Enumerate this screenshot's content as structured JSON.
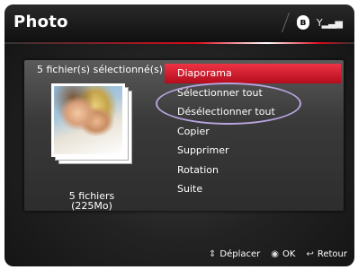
{
  "header": {
    "title": "Photo",
    "icons": [
      "bluetooth-icon",
      "signal-icon"
    ]
  },
  "panel": {
    "selection_text": "5 fichier(s) sélectionné(s)",
    "files_line1": "5 fichiers",
    "files_line2": "(225Mo)"
  },
  "menu": {
    "items": [
      {
        "label": "Diaporama",
        "active": true
      },
      {
        "label": "Sélectionner tout",
        "active": false
      },
      {
        "label": "Désélectionner tout",
        "active": false
      },
      {
        "label": "Copier",
        "active": false
      },
      {
        "label": "Supprimer",
        "active": false
      },
      {
        "label": "Rotation",
        "active": false
      },
      {
        "label": "Suite",
        "active": false
      }
    ],
    "highlight_color": "#b7a3dc",
    "active_color": "#d81a2c"
  },
  "footer": {
    "move_label": "Déplacer",
    "ok_label": "OK",
    "back_label": "Retour"
  }
}
